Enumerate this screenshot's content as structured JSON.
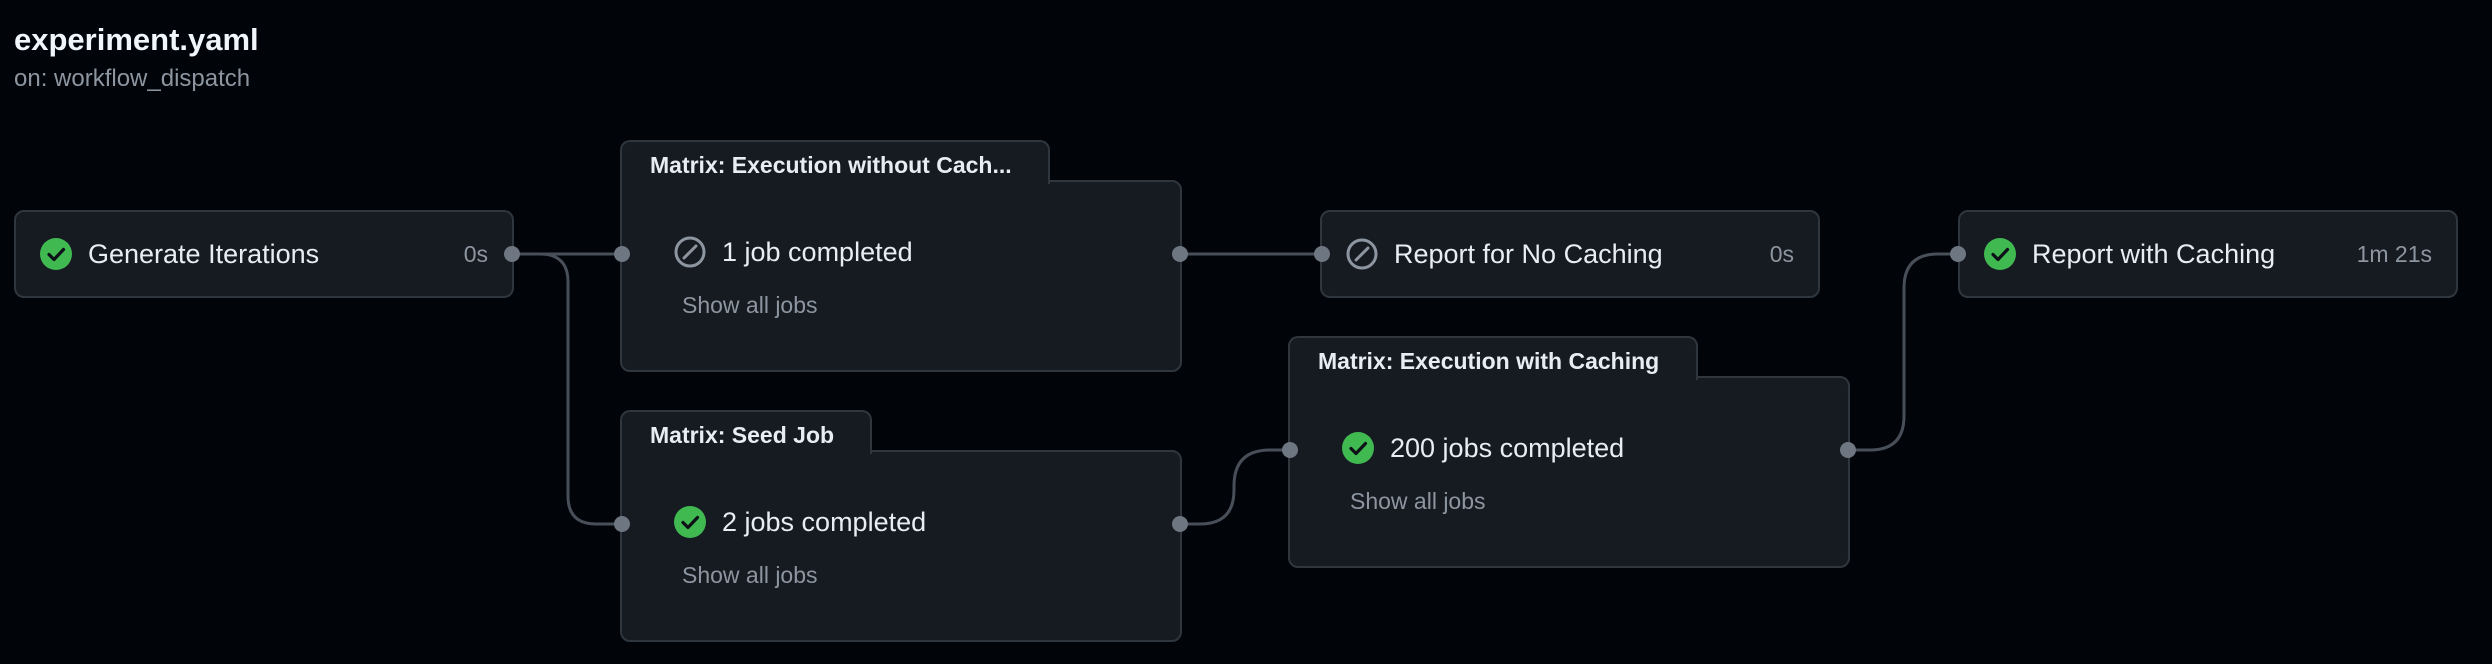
{
  "workflow": {
    "title": "experiment.yaml",
    "trigger": "on: workflow_dispatch"
  },
  "jobs": {
    "generate": {
      "label": "Generate Iterations",
      "duration": "0s",
      "status": "success"
    },
    "report_no_cache": {
      "label": "Report for No Caching",
      "duration": "0s",
      "status": "skipped"
    },
    "report_cache": {
      "label": "Report with Caching",
      "duration": "1m 21s",
      "status": "success"
    }
  },
  "matrices": {
    "no_cache": {
      "title": "Matrix: Execution without Cach...",
      "summary": "1 job completed",
      "link": "Show all jobs",
      "status": "skipped"
    },
    "seed": {
      "title": "Matrix: Seed Job",
      "summary": "2 jobs completed",
      "link": "Show all jobs",
      "status": "success"
    },
    "with_cache": {
      "title": "Matrix: Execution with Caching",
      "summary": "200 jobs completed",
      "link": "Show all jobs",
      "status": "success"
    }
  },
  "colors": {
    "success": "#3fb950",
    "skipped": "#8d96a0",
    "connector": "#6e7681",
    "wire": "#484f58"
  },
  "icons": {
    "success": "check-circle-icon",
    "skipped": "skip-circle-icon"
  }
}
